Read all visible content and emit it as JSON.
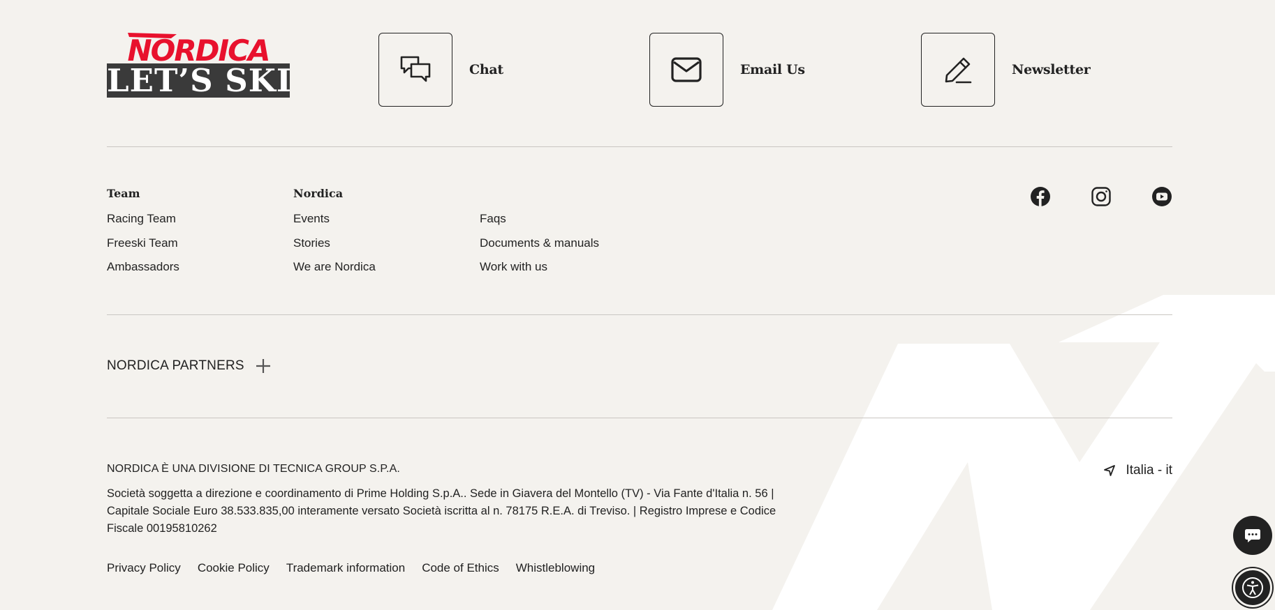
{
  "logo": {
    "brand": "NORDICA",
    "tagline": "LET’S SKI"
  },
  "contacts": [
    {
      "label": "Chat",
      "icon": "chat-icon"
    },
    {
      "label": "Email Us",
      "icon": "mail-icon"
    },
    {
      "label": "Newsletter",
      "icon": "pencil-icon"
    }
  ],
  "columns": {
    "team": {
      "heading": "Team",
      "links": [
        "Racing Team",
        "Freeski Team",
        "Ambassadors"
      ]
    },
    "nordica": {
      "heading": "Nordica",
      "links": [
        "Events",
        "Stories",
        "We are Nordica"
      ]
    },
    "support": {
      "links": [
        "Faqs",
        "Documents & manuals",
        "Work with us"
      ]
    }
  },
  "social": [
    "facebook-icon",
    "instagram-icon",
    "youtube-icon"
  ],
  "partners": {
    "label": "NORDICA PARTNERS"
  },
  "company": {
    "title": "NORDICA È UNA DIVISIONE DI TECNICA GROUP S.P.A.",
    "legal": "Società soggetta a direzione e coordinamento di Prime Holding S.p.A.. Sede in Giavera del Montello (TV) - Via Fante d'Italia n. 56 | Capitale Sociale Euro 38.533.835,00 interamente versato Società iscritta al n. 78175 R.E.A. di Treviso. | Registro Imprese e Codice Fiscale 00195810262"
  },
  "footer_links": [
    "Privacy Policy",
    "Cookie Policy",
    "Trademark information",
    "Code of Ethics",
    "Whistleblowing"
  ],
  "locale": {
    "label": "Italia - it"
  },
  "colors": {
    "brand_red": "#e8112d",
    "background": "#f4f2ee",
    "text": "#222222",
    "tag_bg": "#3a3a3a"
  }
}
